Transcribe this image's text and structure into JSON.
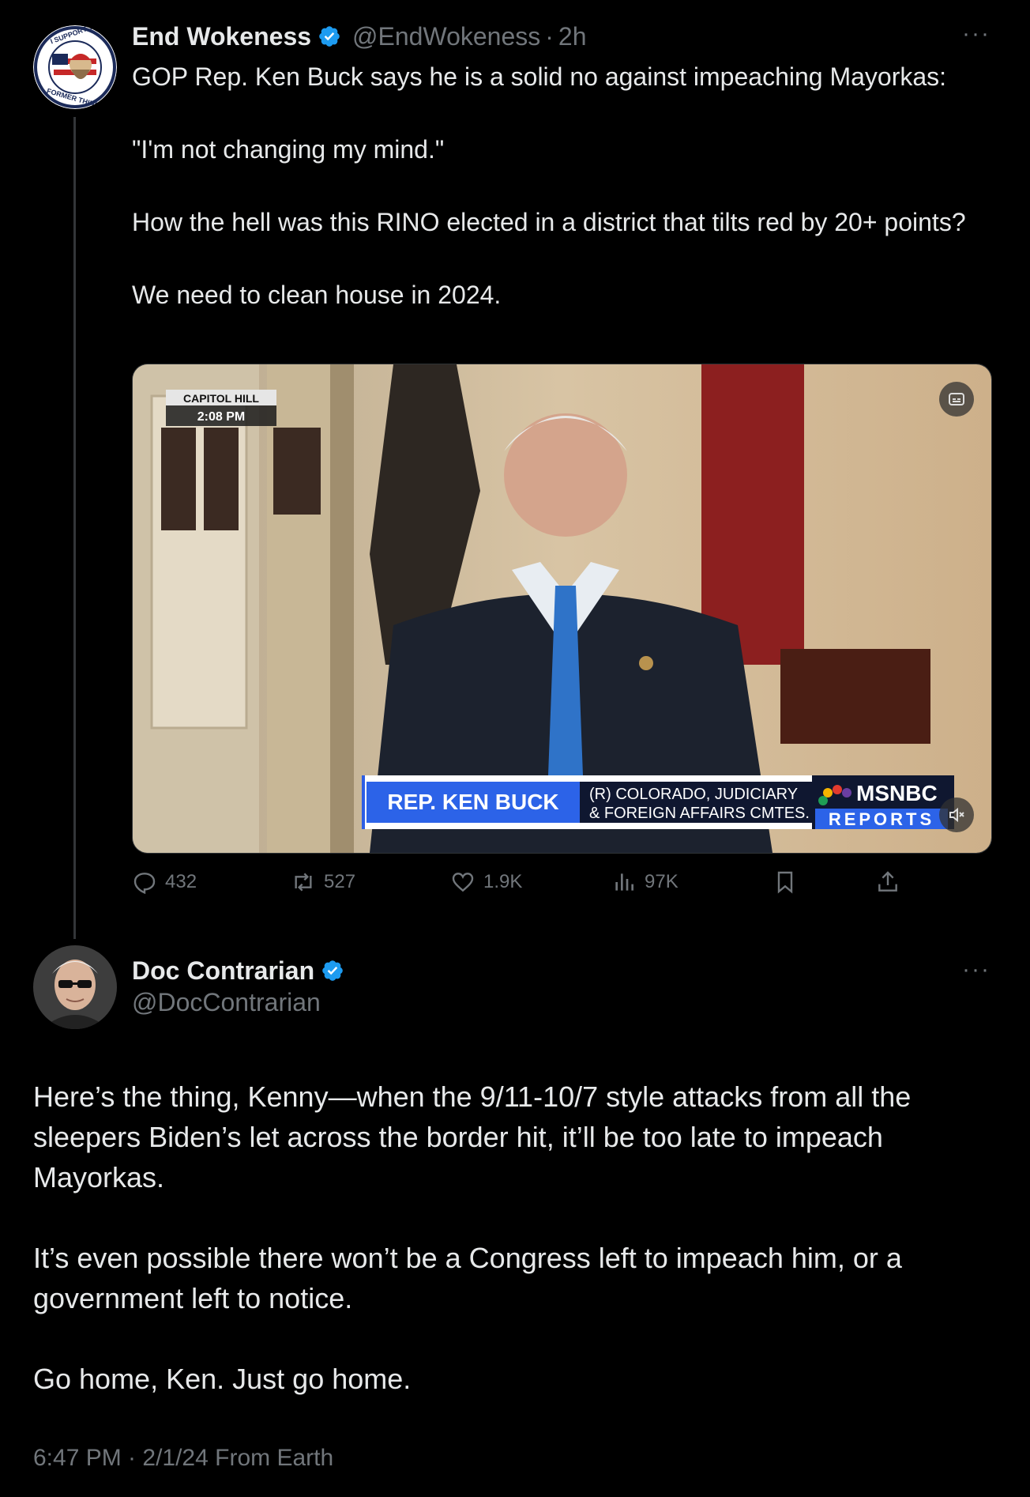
{
  "tweet1": {
    "author_name": "End Wokeness",
    "handle": "@EndWokeness",
    "time": "2h",
    "avatar_text_top": "I SUPPORT THE",
    "avatar_text_bottom": "FORMER THINGS",
    "text": "GOP Rep. Ken Buck says he is a solid no against impeaching Mayorkas:\n\n\"I'm not changing my mind.\"\n\nHow the hell was this RINO elected in a district that tilts red by 20+ points?\n\nWe need to clean house in 2024.",
    "video": {
      "location_label": "CAPITOL HILL",
      "time_label": "2:08 PM",
      "lower_third_name": "REP. KEN BUCK",
      "lower_third_line1": "(R) COLORADO, JUDICIARY",
      "lower_third_line2": "& FOREIGN AFFAIRS CMTES.",
      "network": "MSNBC",
      "program": "REPORTS"
    },
    "actions": {
      "replies": "432",
      "reposts": "527",
      "likes": "1.9K",
      "views": "97K"
    }
  },
  "tweet2": {
    "author_name": "Doc Contrarian",
    "handle": "@DocContrarian",
    "text": "Here’s the thing, Kenny—when the 9/11-10/7 style attacks from all the sleepers Biden’s let across the border hit, it’ll be too late to impeach Mayorkas.\n\nIt’s even possible there won’t be a Congress left to impeach him, or a government left to notice.\n\nGo home, Ken. Just go home.",
    "timestamp": "6:47 PM · 2/1/24 From Earth"
  },
  "more_label": "···",
  "dot_separator": "·",
  "colors": {
    "verified": "#1d9bf0",
    "muted": "#71767b",
    "text": "#e7e9ea"
  }
}
